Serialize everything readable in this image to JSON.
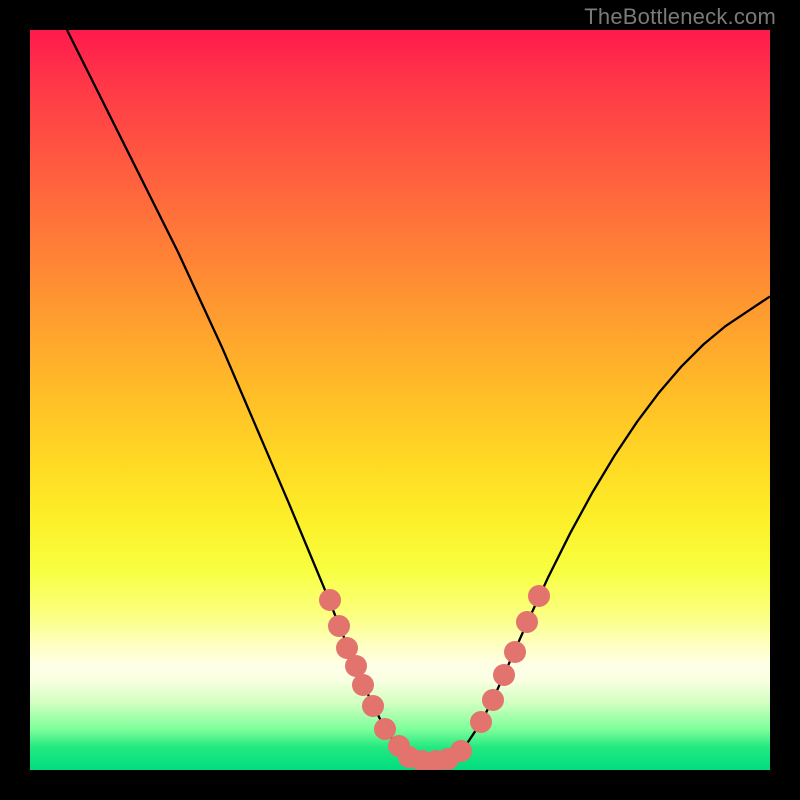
{
  "watermark": "TheBottleneck.com",
  "chart_data": {
    "type": "line",
    "title": "",
    "xlabel": "",
    "ylabel": "",
    "xlim": [
      0,
      1
    ],
    "ylim": [
      0,
      1
    ],
    "curve": {
      "name": "bottleneck-curve",
      "color": "#000000",
      "points": [
        {
          "x": 0.05,
          "y": 1.0
        },
        {
          "x": 0.08,
          "y": 0.94
        },
        {
          "x": 0.11,
          "y": 0.88
        },
        {
          "x": 0.14,
          "y": 0.82
        },
        {
          "x": 0.17,
          "y": 0.76
        },
        {
          "x": 0.2,
          "y": 0.7
        },
        {
          "x": 0.23,
          "y": 0.635
        },
        {
          "x": 0.26,
          "y": 0.57
        },
        {
          "x": 0.29,
          "y": 0.5
        },
        {
          "x": 0.32,
          "y": 0.43
        },
        {
          "x": 0.35,
          "y": 0.36
        },
        {
          "x": 0.375,
          "y": 0.3
        },
        {
          "x": 0.4,
          "y": 0.24
        },
        {
          "x": 0.42,
          "y": 0.19
        },
        {
          "x": 0.44,
          "y": 0.14
        },
        {
          "x": 0.46,
          "y": 0.095
        },
        {
          "x": 0.48,
          "y": 0.055
        },
        {
          "x": 0.5,
          "y": 0.028
        },
        {
          "x": 0.515,
          "y": 0.015
        },
        {
          "x": 0.53,
          "y": 0.01
        },
        {
          "x": 0.545,
          "y": 0.01
        },
        {
          "x": 0.56,
          "y": 0.012
        },
        {
          "x": 0.575,
          "y": 0.02
        },
        {
          "x": 0.59,
          "y": 0.035
        },
        {
          "x": 0.61,
          "y": 0.065
        },
        {
          "x": 0.63,
          "y": 0.105
        },
        {
          "x": 0.65,
          "y": 0.15
        },
        {
          "x": 0.67,
          "y": 0.195
        },
        {
          "x": 0.7,
          "y": 0.26
        },
        {
          "x": 0.73,
          "y": 0.32
        },
        {
          "x": 0.76,
          "y": 0.375
        },
        {
          "x": 0.79,
          "y": 0.425
        },
        {
          "x": 0.82,
          "y": 0.47
        },
        {
          "x": 0.85,
          "y": 0.51
        },
        {
          "x": 0.88,
          "y": 0.545
        },
        {
          "x": 0.91,
          "y": 0.575
        },
        {
          "x": 0.94,
          "y": 0.6
        },
        {
          "x": 0.97,
          "y": 0.62
        },
        {
          "x": 1.0,
          "y": 0.64
        }
      ]
    },
    "markers": {
      "color": "#e2736d",
      "radius_px": 11,
      "points": [
        {
          "x": 0.405,
          "y": 0.23
        },
        {
          "x": 0.418,
          "y": 0.195
        },
        {
          "x": 0.428,
          "y": 0.165
        },
        {
          "x": 0.44,
          "y": 0.14
        },
        {
          "x": 0.45,
          "y": 0.115
        },
        {
          "x": 0.464,
          "y": 0.086
        },
        {
          "x": 0.48,
          "y": 0.055
        },
        {
          "x": 0.498,
          "y": 0.032
        },
        {
          "x": 0.512,
          "y": 0.018
        },
        {
          "x": 0.53,
          "y": 0.012
        },
        {
          "x": 0.548,
          "y": 0.012
        },
        {
          "x": 0.565,
          "y": 0.015
        },
        {
          "x": 0.582,
          "y": 0.026
        },
        {
          "x": 0.61,
          "y": 0.065
        },
        {
          "x": 0.625,
          "y": 0.095
        },
        {
          "x": 0.64,
          "y": 0.128
        },
        {
          "x": 0.655,
          "y": 0.16
        },
        {
          "x": 0.672,
          "y": 0.2
        },
        {
          "x": 0.688,
          "y": 0.235
        }
      ]
    },
    "gradient_stops": [
      {
        "pos": 0.0,
        "color": "#ff1a4d"
      },
      {
        "pos": 0.5,
        "color": "#ffc828"
      },
      {
        "pos": 0.86,
        "color": "#ffffe8"
      },
      {
        "pos": 1.0,
        "color": "#00dd80"
      }
    ]
  }
}
